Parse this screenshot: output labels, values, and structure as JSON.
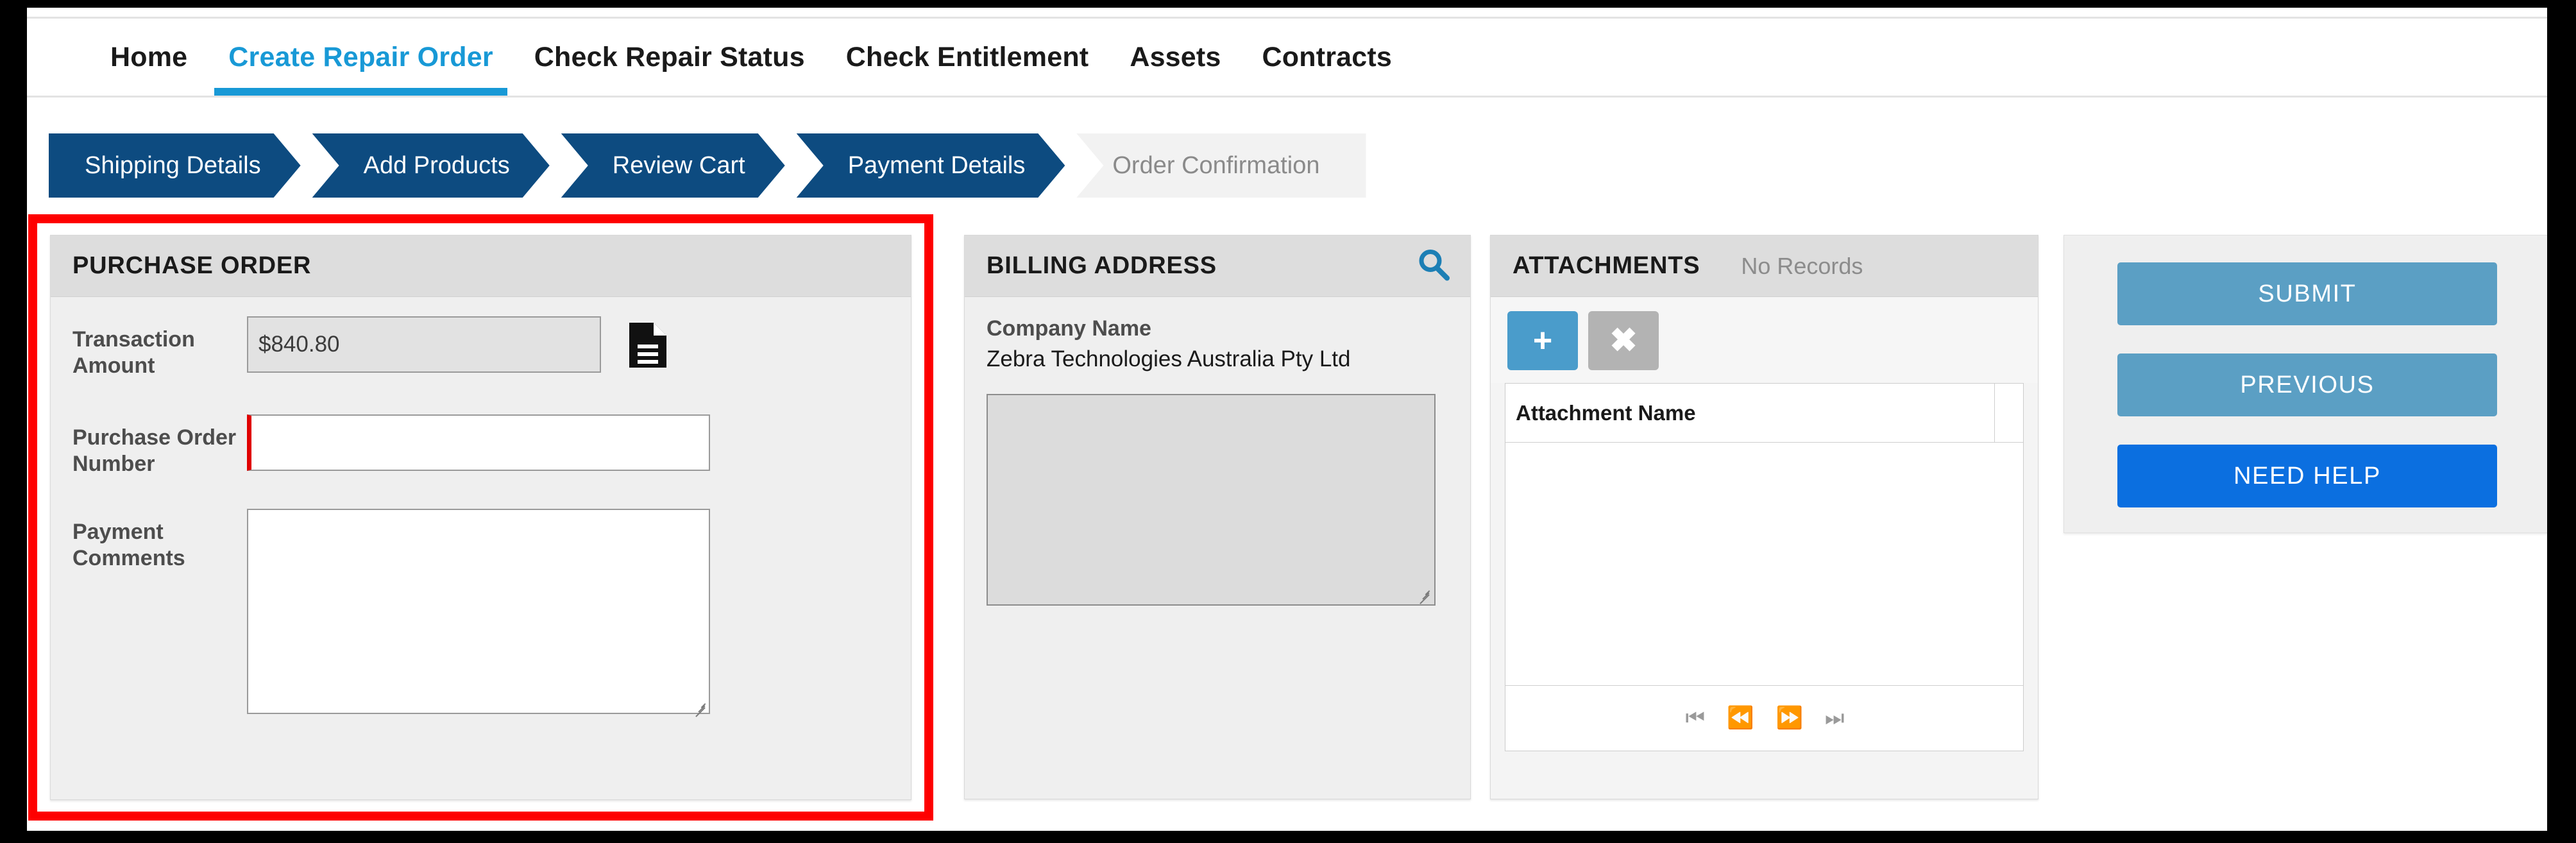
{
  "nav": {
    "items": [
      {
        "label": "Home",
        "active": false
      },
      {
        "label": "Create Repair Order",
        "active": true
      },
      {
        "label": "Check Repair Status",
        "active": false
      },
      {
        "label": "Check Entitlement",
        "active": false
      },
      {
        "label": "Assets",
        "active": false
      },
      {
        "label": "Contracts",
        "active": false
      }
    ]
  },
  "steps": [
    {
      "label": "Shipping Details",
      "state": "completed"
    },
    {
      "label": "Add Products",
      "state": "completed"
    },
    {
      "label": "Review Cart",
      "state": "completed"
    },
    {
      "label": "Payment Details",
      "state": "current"
    },
    {
      "label": "Order Confirmation",
      "state": "upcoming"
    }
  ],
  "purchase_order": {
    "title": "PURCHASE ORDER",
    "transaction_amount": {
      "label": "Transaction Amount",
      "value": "$840.80",
      "readonly": true
    },
    "document_icon": "document-icon",
    "po_number": {
      "label": "Purchase Order Number",
      "value": "",
      "placeholder": "",
      "required": true
    },
    "payment_comments": {
      "label": "Payment Comments",
      "value": "",
      "placeholder": ""
    }
  },
  "billing_address": {
    "title": "BILLING ADDRESS",
    "search_icon": "search-icon",
    "company_name_label": "Company Name",
    "company_name_value": "Zebra Technologies Australia Pty Ltd",
    "address_value": "",
    "address_placeholder": ""
  },
  "attachments": {
    "title": "ATTACHMENTS",
    "status": "No Records",
    "add_label": "+",
    "remove_label": "✖",
    "columns": [
      "Attachment Name"
    ],
    "rows": [],
    "pager": {
      "first": "⏮",
      "previous": "⏪",
      "next": "⏩",
      "last": "⏭"
    }
  },
  "actions": {
    "submit": "SUBMIT",
    "previous": "PREVIOUS",
    "need_help": "NEED HELP"
  },
  "colors": {
    "accent_blue": "#1899d6",
    "step_blue": "#0d4b80",
    "highlight_red": "#fe0000",
    "button_blue": "#5b9fc4",
    "help_blue": "#0b6fe0",
    "add_blue": "#4a9ccb",
    "required_red": "#e00000"
  }
}
